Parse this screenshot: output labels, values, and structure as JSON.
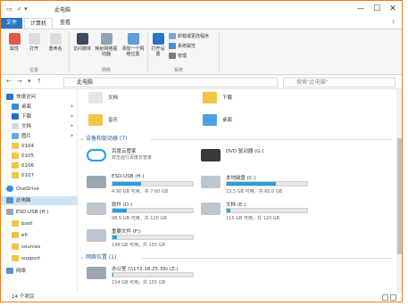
{
  "window": {
    "title": "此电脑",
    "controls": [
      "—",
      "☐",
      "✕"
    ]
  },
  "tabs": [
    {
      "label": "文件"
    },
    {
      "label": "计算机"
    },
    {
      "label": "查看"
    }
  ],
  "ribbon": {
    "location": {
      "label": "位置",
      "buttons": [
        "属性",
        "打开",
        "重命名"
      ]
    },
    "network": {
      "label": "网络",
      "buttons": [
        "访问媒体",
        "映射网络驱动器",
        "添加一个网络位置"
      ]
    },
    "system": {
      "label": "系统",
      "open_settings": "打开设置",
      "items": [
        "卸载或更改程序",
        "系统属性",
        "管理"
      ]
    }
  },
  "address": {
    "path": "此电脑",
    "search_placeholder": "搜索\"此电脑\""
  },
  "sidebar": [
    {
      "label": "快速访问"
    },
    {
      "label": "桌面"
    },
    {
      "label": "下载"
    },
    {
      "label": "文档"
    },
    {
      "label": "图片"
    },
    {
      "label": "0104"
    },
    {
      "label": "0105"
    },
    {
      "label": "0106"
    },
    {
      "label": "0107"
    },
    {
      "label": "OneDrive"
    },
    {
      "label": "此电脑"
    },
    {
      "label": "ESD-USB (H:)"
    },
    {
      "label": "boot"
    },
    {
      "label": "efi"
    },
    {
      "label": "sources"
    },
    {
      "label": "support"
    },
    {
      "label": "网络"
    }
  ],
  "folders": [
    {
      "label": "文档"
    },
    {
      "label": "下载"
    },
    {
      "label": "音乐"
    },
    {
      "label": "桌面"
    }
  ],
  "devices": {
    "header": "设备和驱动器 (7)",
    "items": [
      {
        "name": "百度云管家",
        "sub": "双击运行百度云管家"
      },
      {
        "name": "DVD 驱动器 (G:)",
        "sub": ""
      },
      {
        "name": "ESD-USB (H:)",
        "free": "4.90 GB 可用，共 7.60 GB",
        "used": 0.36
      },
      {
        "name": "本地磁盘 (C:)",
        "free": "23.5 GB 可用，共 60.0 GB",
        "used": 0.61
      },
      {
        "name": "软件 (D:)",
        "free": "98.5 GB 可用，共 120 GB",
        "used": 0.18
      },
      {
        "name": "文档 (E:)",
        "free": "115 GB 可用，共 120 GB",
        "used": 0.04
      },
      {
        "name": "重要文件 (F:)",
        "free": "148 GB 可用，共 155 GB",
        "used": 0.05
      }
    ]
  },
  "network_locations": {
    "header": "网络位置 (1)",
    "items": [
      {
        "name": "办公室 (\\\\172.16.25.39) (Z:)",
        "free": "154 GB 可用，共 155 GB",
        "used": 0.01
      }
    ]
  },
  "status": {
    "count": "14 个项目"
  }
}
